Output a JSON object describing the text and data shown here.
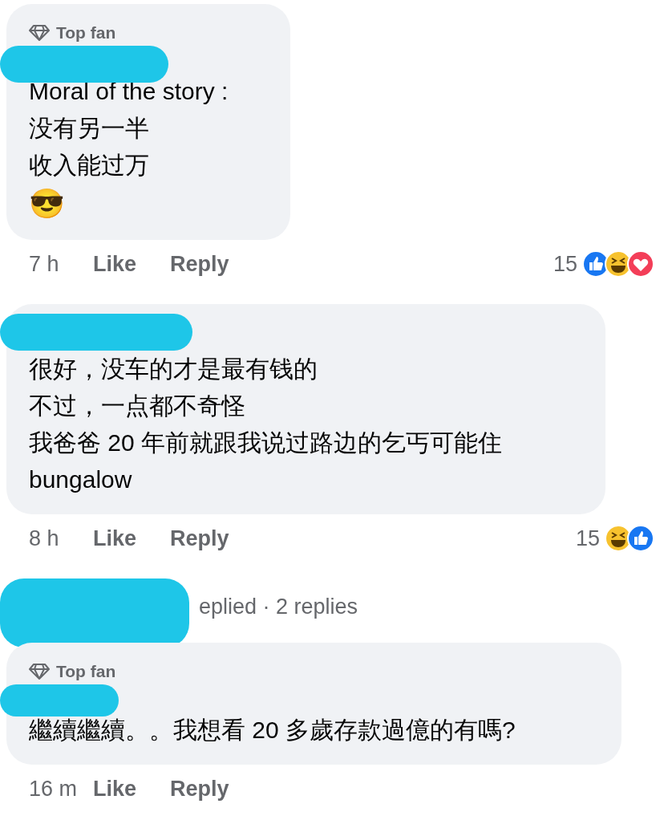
{
  "comments": [
    {
      "top_fan": true,
      "badge": "Top fan",
      "lines": [
        "Moral of the story :",
        "没有另一半",
        "收入能过万"
      ],
      "emoji": "😎",
      "time": "7 h",
      "actions": [
        "Like",
        "Reply"
      ],
      "reaction_count": "15",
      "reactions": [
        {
          "kind": "like"
        },
        {
          "kind": "haha"
        },
        {
          "kind": "love"
        }
      ]
    },
    {
      "top_fan": false,
      "lines": [
        "很好，没车的才是最有钱的",
        "不过，一点都不奇怪",
        "我爸爸 20 年前就跟我说过路边的乞丐可能住",
        "bungalow"
      ],
      "time": "8 h",
      "actions": [
        "Like",
        "Reply"
      ],
      "reaction_count": "15",
      "reactions": [
        {
          "kind": "haha"
        },
        {
          "kind": "like"
        }
      ],
      "replies": "eplied · 2 replies"
    },
    {
      "top_fan": true,
      "badge": "Top fan",
      "lines": [
        "繼續繼續。。我想看 20 多歲存款過億的有嗎?"
      ],
      "time": "16 m",
      "actions": [
        "Like",
        "Reply"
      ]
    }
  ]
}
